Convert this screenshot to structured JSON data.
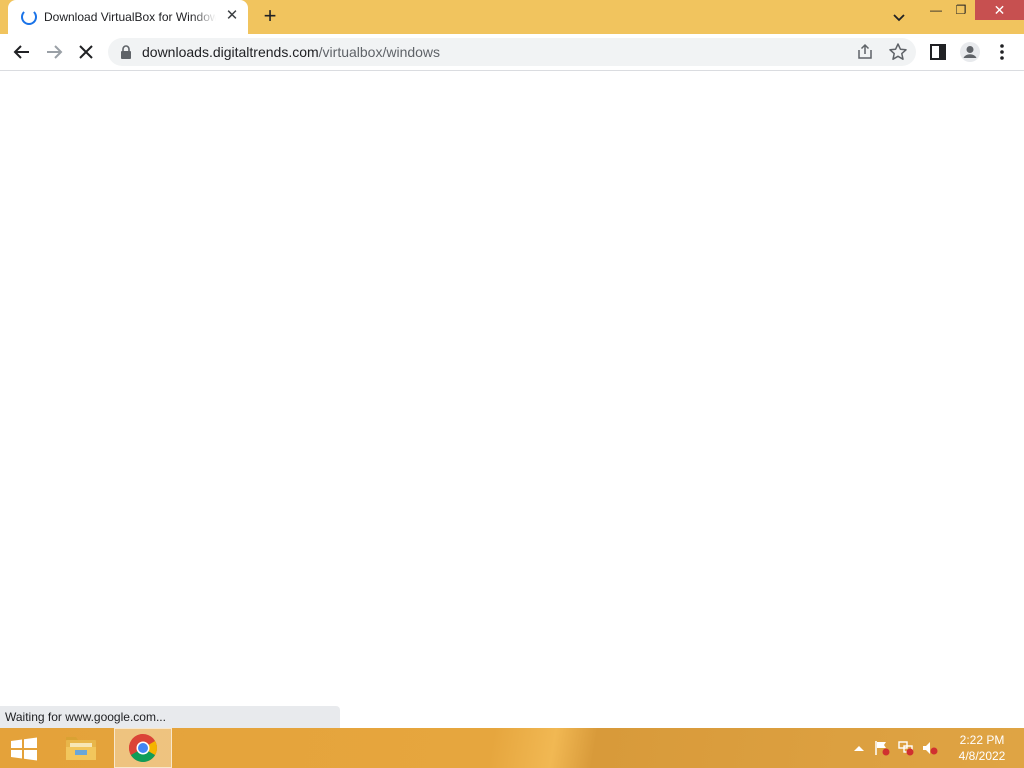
{
  "browser": {
    "tab": {
      "title": "Download VirtualBox for Windows",
      "close": "✕"
    },
    "newtab": "+",
    "window": {
      "minimize": "—",
      "maximize": "❐",
      "close": "✕"
    },
    "url": {
      "host": "downloads.digitaltrends.com",
      "path": "/virtualbox/windows"
    },
    "status": "Waiting for www.google.com..."
  },
  "taskbar": {
    "time": "2:22 PM",
    "date": "4/8/2022",
    "apps": [
      "file-explorer",
      "chrome"
    ]
  },
  "colors": {
    "titlebar": "#f1c45e",
    "taskbar": "#e4a23a",
    "close_hover": "#c75050",
    "spinner": "#1a73e8"
  }
}
